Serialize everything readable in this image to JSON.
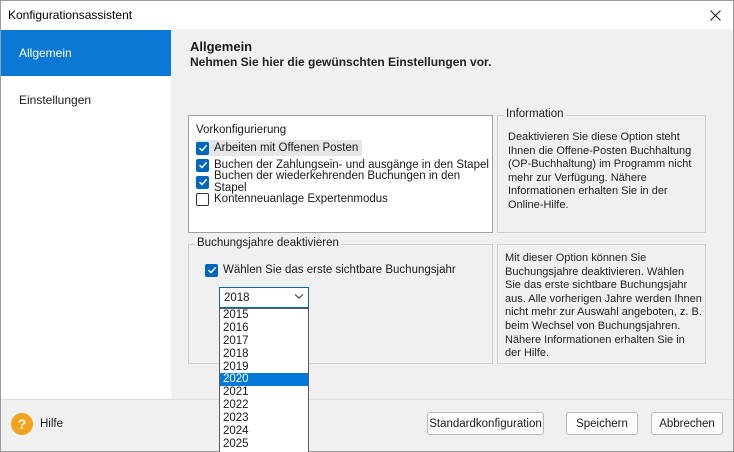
{
  "window": {
    "title": "Konfigurationsassistent"
  },
  "sidebar": {
    "items": [
      {
        "label": "Allgemein",
        "active": true
      },
      {
        "label": "Einstellungen",
        "active": false
      }
    ]
  },
  "main": {
    "heading": "Allgemein",
    "subheading": "Nehmen Sie hier die gewünschten Einstellungen vor.",
    "vorkonfig": {
      "title": "Vorkonfigurierung",
      "options": [
        {
          "label": "Arbeiten mit Offenen Posten",
          "checked": true
        },
        {
          "label": "Buchen der Zahlungsein- und ausgänge in den Stapel",
          "checked": true
        },
        {
          "label": "Buchen der wiederkehrenden Buchungen in den Stapel",
          "checked": true
        },
        {
          "label": "Kontenneuanlage Expertenmodus",
          "checked": false
        }
      ]
    },
    "information": {
      "title": "Information",
      "text": "Deaktivieren Sie diese Option steht Ihnen die Offene-Posten Buchhaltung (OP-Buchhaltung) im Programm nicht mehr zur Verfügung. Nähere Informationen erhalten Sie in der Online-Hilfe."
    },
    "buchungsjahre": {
      "title": "Buchungsjahre deaktivieren",
      "option": {
        "label": "Wählen Sie das erste sichtbare Buchungsjahr",
        "checked": true
      },
      "selected_year": "2018",
      "years": [
        "2015",
        "2016",
        "2017",
        "2018",
        "2019",
        "2020",
        "2021",
        "2022",
        "2023",
        "2024",
        "2025"
      ],
      "highlighted_year": "2020",
      "info_text": "Mit dieser Option können Sie Buchungsjahre deaktivieren. Wählen Sie das erste sichtbare Buchungsjahr aus. Alle vorherigen Jahre werden Ihnen nicht mehr zur Auswahl angeboten, z. B. beim Wechsel von Buchungsjahren. Nähere Informationen erhalten Sie in der Hilfe."
    }
  },
  "footer": {
    "help_label": "Hilfe",
    "buttons": {
      "default_config": "Standardkonfiguration",
      "save": "Speichern",
      "cancel": "Abbrechen"
    }
  },
  "colors": {
    "accent": "#0a78d4",
    "checkbox": "#0067c0",
    "help": "#f2a21c"
  }
}
